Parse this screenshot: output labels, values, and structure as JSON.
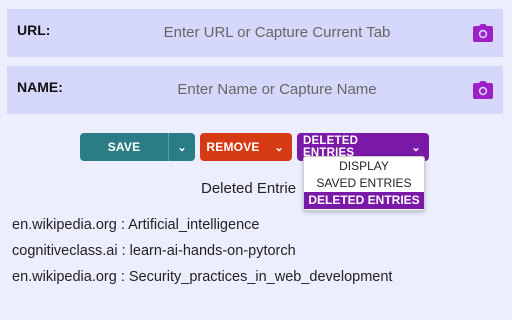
{
  "url_field": {
    "label": "URL:",
    "value": "",
    "placeholder": "Enter URL or Capture Current Tab",
    "icon": "camera-icon"
  },
  "name_field": {
    "label": "NAME:",
    "value": "",
    "placeholder": "Enter Name or Capture Name",
    "icon": "camera-icon"
  },
  "buttons": {
    "save": {
      "label": "SAVE",
      "color": "#2a7c85"
    },
    "remove": {
      "label": "REMOVE",
      "color": "#d53a14"
    },
    "deleted_entries": {
      "label": "DELETED ENTRIES",
      "color": "#7a18a8"
    }
  },
  "dropdown": {
    "selected": "DELETED ENTRIES",
    "options": [
      "DISPLAY",
      "SAVED ENTRIES",
      "DELETED ENTRIES"
    ]
  },
  "section_title": "Deleted Entrie",
  "entries": [
    "en.wikipedia.org : Artificial_intelligence",
    "cognitiveclass.ai : learn-ai-hands-on-pytorch",
    "en.wikipedia.org : Security_practices_in_web_development"
  ],
  "colors": {
    "background": "#eceefe",
    "field_bg": "#d5d8fb",
    "accent_purple": "#7a18a8",
    "icon_purple": "#a020c8"
  }
}
